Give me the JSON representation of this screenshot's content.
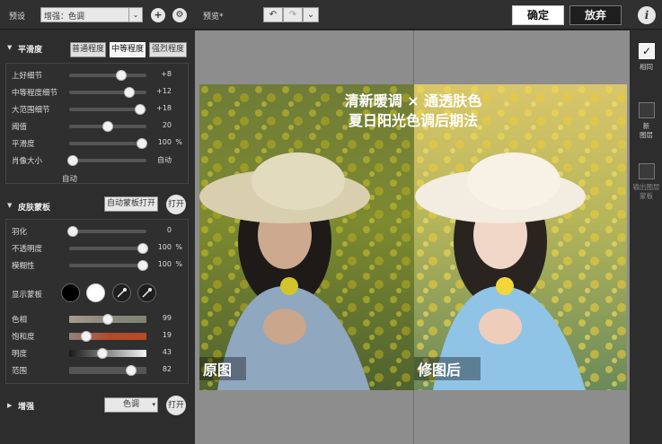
{
  "topbar": {
    "preset_label": "预设",
    "preset_value": "增强：色调",
    "add_symbol": "+",
    "gear_symbol": "⚙",
    "preview_label": "预览*",
    "undo_symbol": "↶",
    "redo_symbol": "↷",
    "chevron_symbol": "⌄",
    "confirm_label": "确定",
    "discard_label": "放弃",
    "info_symbol": "i"
  },
  "smoothing": {
    "title": "平滑度",
    "modes": [
      "普通程度",
      "中等程度",
      "强烈程度"
    ],
    "sliders": [
      {
        "name": "上好细节",
        "value": "+8",
        "unit": "",
        "pos": 0.68
      },
      {
        "name": "中等程度细节",
        "value": "+12",
        "unit": "",
        "pos": 0.78
      },
      {
        "name": "大范围细节",
        "value": "+18",
        "unit": "",
        "pos": 0.92
      },
      {
        "name": "阈值",
        "value": "20",
        "unit": "",
        "pos": 0.5
      },
      {
        "name": "平滑度",
        "value": "100",
        "unit": "%",
        "pos": 0.94
      },
      {
        "name": "肖像大小",
        "value": "自动",
        "unit": "",
        "pos": 0.05
      }
    ],
    "auto_label": "自动"
  },
  "skin_mask": {
    "title": "皮肤蒙板",
    "auto_button": "自动蒙板打开",
    "toggle_label": "打开",
    "sliders": [
      {
        "name": "羽化",
        "value": "0",
        "unit": "",
        "pos": 0.05
      },
      {
        "name": "不透明度",
        "value": "100",
        "unit": "%",
        "pos": 0.95
      },
      {
        "name": "模糊性",
        "value": "100",
        "unit": "%",
        "pos": 0.95
      }
    ],
    "show_mask_label": "显示蒙板",
    "color_sliders": [
      {
        "name": "色相",
        "value": "99",
        "pos": 0.5,
        "colors": [
          "#a89b92",
          "#8a8878",
          "#7d8671"
        ]
      },
      {
        "name": "饱和度",
        "value": "19",
        "pos": 0.22,
        "colors": [
          "#8e8380",
          "#b24a2a",
          "#b94a22"
        ]
      },
      {
        "name": "明度",
        "value": "43",
        "pos": 0.43,
        "colors": [
          "#1a1a1a",
          "#888888",
          "#f5f5f5"
        ]
      },
      {
        "name": "范围",
        "value": "82",
        "pos": 0.8,
        "colors": [
          "#555555",
          "#555555",
          "#555555"
        ]
      }
    ]
  },
  "enhance": {
    "title": "增强",
    "mode_value": "色调",
    "toggle_label": "打开"
  },
  "photo": {
    "headline_1": "清新暖调 × 通透肤色",
    "headline_2": "夏日阳光色调后期法",
    "label_before": "原图",
    "label_after": "修图后"
  },
  "right_panel": {
    "same_label": "相同",
    "new_layer_label": "新\n图层",
    "output_layer_label": "输出图层\n蒙板"
  },
  "colors": {
    "accent_confirm": "#ffffff",
    "accent_discard": "#1e1e1e"
  }
}
